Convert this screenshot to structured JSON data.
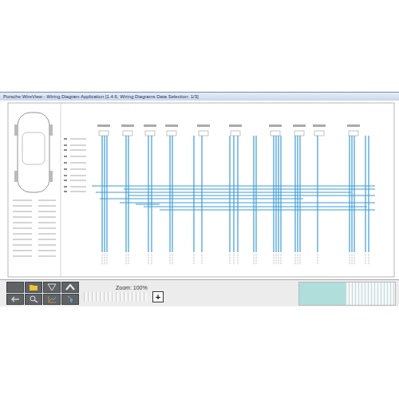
{
  "window": {
    "title": "Porsche WireView - Wiring Diagram Application [1.4.6, Wiring Diagrams Data Selection: 1/3]"
  },
  "toolbar": {
    "zoom_label": "Zoom: 100%",
    "zoom_in": "+"
  }
}
